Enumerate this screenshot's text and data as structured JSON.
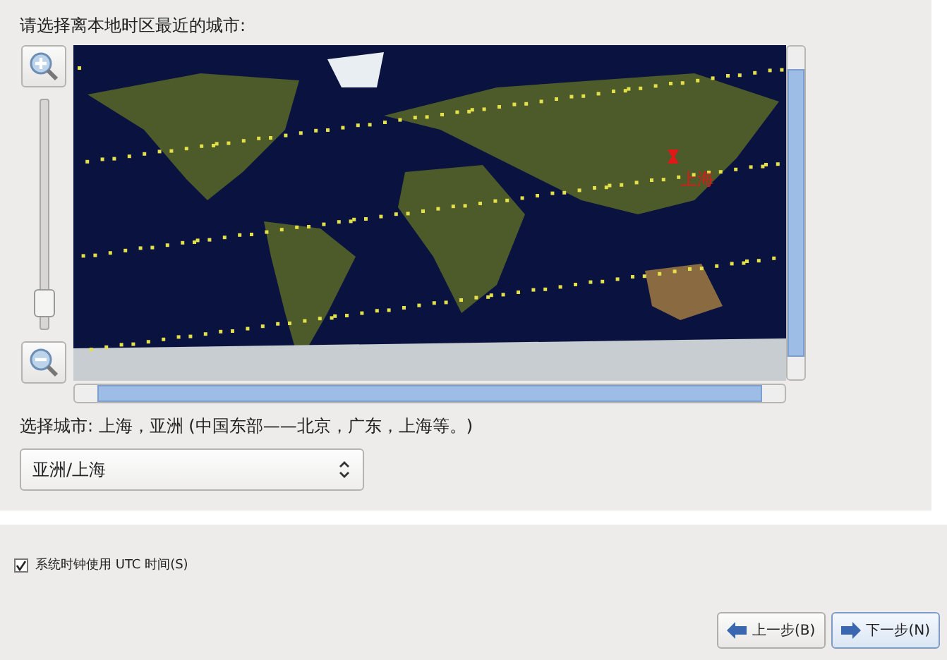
{
  "prompt": "请选择离本地时区最近的城市:",
  "zoom_slider": {
    "level": 0.05
  },
  "map": {
    "marker_label": "上海"
  },
  "selected_city_text": "选择城市: 上海，亚洲 (中国东部——北京，广东，上海等。)",
  "city_dropdown": {
    "value": "亚洲/上海"
  },
  "utc_checkbox": {
    "label": "系统时钟使用 UTC 时间(S)",
    "checked": true
  },
  "buttons": [
    {
      "kind": "back",
      "label": "上一步(B)",
      "selected": false
    },
    {
      "kind": "next",
      "label": "下一步(N)",
      "selected": true
    }
  ]
}
